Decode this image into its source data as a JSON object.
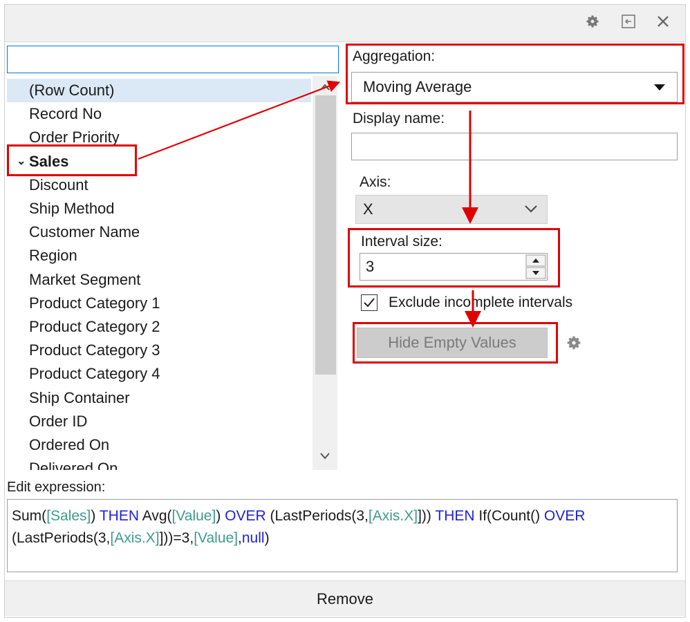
{
  "toolbar": {
    "settings_icon": "gear-icon",
    "dock_icon": "dock-icon",
    "close_icon": "close-icon"
  },
  "search": {
    "value": "",
    "placeholder": ""
  },
  "columns": {
    "items": [
      "(Row Count)",
      "Record No",
      "Order Priority",
      "Sales",
      "Discount",
      "Ship Method",
      "Customer Name",
      "Region",
      "Market Segment",
      "Product Category 1",
      "Product Category 2",
      "Product Category 3",
      "Product Category 4",
      "Ship Container",
      "Order ID",
      "Ordered On",
      "Delivered On"
    ],
    "selected_item": "(Row Count)",
    "checked_item": "Sales"
  },
  "aggregation": {
    "label": "Aggregation:",
    "value": "Moving Average"
  },
  "display_name": {
    "label": "Display name:",
    "value": ""
  },
  "axis": {
    "label": "Axis:",
    "value": "X"
  },
  "interval": {
    "label": "Interval size:",
    "value": "3"
  },
  "exclude": {
    "label": "Exclude incomplete intervals",
    "checked": true
  },
  "hide_empty": {
    "label": "Hide Empty Values",
    "settings_icon": "gear-icon"
  },
  "expression": {
    "label": "Edit expression:",
    "tokens": [
      {
        "t": "Sum(",
        "c": "plain"
      },
      {
        "t": "[Sales]",
        "c": "col"
      },
      {
        "t": ") ",
        "c": "plain"
      },
      {
        "t": "THEN",
        "c": "kw"
      },
      {
        "t": " Avg(",
        "c": "plain"
      },
      {
        "t": "[Value]",
        "c": "col"
      },
      {
        "t": ") ",
        "c": "plain"
      },
      {
        "t": "OVER",
        "c": "kw"
      },
      {
        "t": " (LastPeriods(3,",
        "c": "plain"
      },
      {
        "t": "[Axis.X]",
        "c": "col"
      },
      {
        "t": "])) ",
        "c": "plain"
      },
      {
        "t": "THEN",
        "c": "kw"
      },
      {
        "t": " If(Count() ",
        "c": "plain"
      },
      {
        "t": "OVER",
        "c": "kw"
      },
      {
        "t": " (LastPeriods(3,",
        "c": "plain"
      },
      {
        "t": "[Axis.X]",
        "c": "col"
      },
      {
        "t": "]))=3,",
        "c": "plain"
      },
      {
        "t": "[Value]",
        "c": "col"
      },
      {
        "t": ",",
        "c": "plain"
      },
      {
        "t": "null",
        "c": "kw"
      },
      {
        "t": ")",
        "c": "plain"
      }
    ]
  },
  "remove": {
    "label": "Remove"
  },
  "colors": {
    "annotation": "#e00000",
    "keyword": "#1f1fd9",
    "column_ref": "#3f9a8d",
    "selection": "#dbe8f5"
  }
}
